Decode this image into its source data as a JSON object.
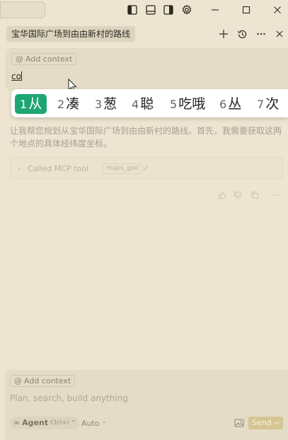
{
  "titlebar": {
    "icons": [
      "toggle-primary-sidebar-icon",
      "toggle-panel-icon",
      "toggle-secondary-sidebar-icon",
      "settings-gear-icon"
    ],
    "window_controls": [
      "minimize-icon",
      "maximize-icon",
      "close-icon"
    ]
  },
  "chat": {
    "tab_title": "宝华国际广场到由由新村的路线",
    "actions": [
      "new-chat-icon",
      "history-icon",
      "more-icon",
      "close-icon"
    ]
  },
  "composer_top": {
    "context_label": "Add context",
    "typed_text": "co"
  },
  "ime": {
    "candidates": [
      {
        "n": "1",
        "text": "从"
      },
      {
        "n": "2",
        "text": "凑"
      },
      {
        "n": "3",
        "text": "葱"
      },
      {
        "n": "4",
        "text": "聪"
      },
      {
        "n": "5",
        "text": "吃哦"
      },
      {
        "n": "6",
        "text": "丛"
      },
      {
        "n": "7",
        "text": "次"
      }
    ],
    "selected_index": 0,
    "selected_color": "#1ea672"
  },
  "message": {
    "text": "让我帮您规划从宝华国际广场到由由新村的路线。首先，我需要获取这两个地点的具体经纬度坐标。",
    "tool_call_label": "Called MCP tool",
    "tool_name": "maps_geo"
  },
  "composer_bottom": {
    "context_label": "Add context",
    "placeholder": "Plan, search, build anything",
    "agent_label": "Agent",
    "agent_shortcut": "Ctrl+I",
    "model_label": "Auto",
    "send_label": "Send",
    "send_color": "#d4c594"
  }
}
